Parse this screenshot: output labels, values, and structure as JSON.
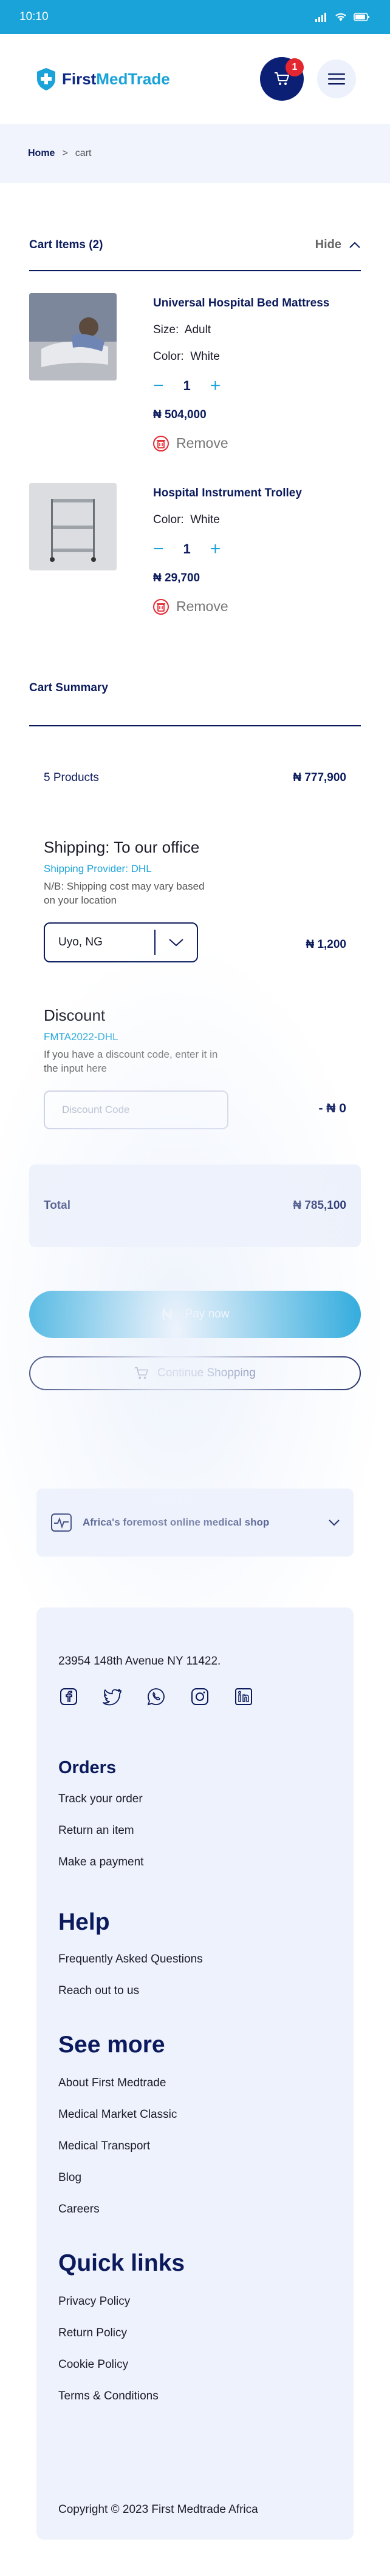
{
  "status_bar": {
    "time": "10:10"
  },
  "header": {
    "logo_first": "First",
    "logo_medtrade": "MedTrade",
    "cart_count": "1"
  },
  "breadcrumb": {
    "home": "Home",
    "separator": ">",
    "current": "cart"
  },
  "cart": {
    "title": "Cart Items (2)",
    "hide_label": "Hide",
    "items": [
      {
        "name": "Universal Hospital Bed Mattress",
        "size_label": "Size:",
        "size": "Adult",
        "color_label": "Color:",
        "color": "White",
        "quantity": "1",
        "price": "₦ 504,000",
        "remove_label": "Remove"
      },
      {
        "name": "Hospital Instrument Trolley",
        "color_label": "Color:",
        "color": "White",
        "quantity": "1",
        "price": "₦ 29,700",
        "remove_label": "Remove"
      }
    ]
  },
  "summary": {
    "title": "Cart Summary",
    "products_label": "5 Products",
    "products_amount": "₦ 777,900",
    "shipping_heading": "Shipping: To our office",
    "shipping_provider": "Shipping Provider: DHL",
    "shipping_note": "N/B: Shipping cost may vary based on your location",
    "shipping_location": "Uyo, NG",
    "shipping_amount": "₦ 1,200",
    "discount_heading": "Discount",
    "discount_code": "FMTA2022-DHL",
    "discount_note": "If you have a discount code, enter it in the input here",
    "discount_placeholder": "Discount Code",
    "discount_amount": "- ₦ 0",
    "total_label": "Total",
    "total_amount": "₦ 785,100",
    "pay_label": "Pay now",
    "continue_label": "Continue Shopping"
  },
  "tagline": "Africa's foremost online medical shop",
  "footer": {
    "address": "23954 148th Avenue NY 11422.",
    "orders_title": "Orders",
    "orders_links": [
      "Track your order",
      "Return an item",
      "Make a payment"
    ],
    "help_title": "Help",
    "help_links": [
      "Frequently Asked Questions",
      "Reach out to us"
    ],
    "more_title": "See more",
    "more_links": [
      "About First Medtrade",
      "Medical Market Classic",
      "Medical Transport",
      "Blog",
      "Careers"
    ],
    "quick_title": "Quick links",
    "quick_links": [
      "Privacy Policy",
      "Return Policy",
      "Cookie Policy",
      "Terms & Conditions"
    ],
    "copyright": "Copyright © 2023 First Medtrade Africa"
  },
  "colors": {
    "brand_navy": "#0b1a5c",
    "brand_blue": "#1aa3d9",
    "badge_red": "#e3262f",
    "panel_bg": "#eef2fc"
  }
}
